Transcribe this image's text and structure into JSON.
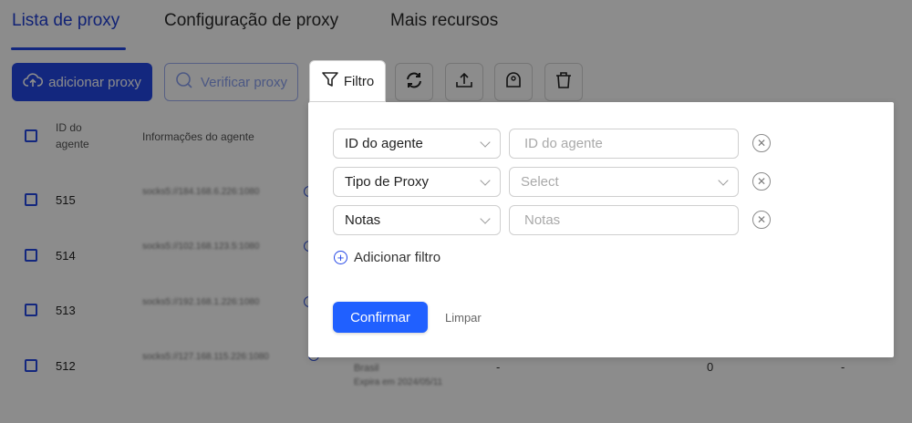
{
  "tabs": [
    "Lista de proxy",
    "Configuração de proxy",
    "Mais recursos"
  ],
  "toolbar": {
    "add_label": "adicionar proxy",
    "verify_label": "Verificar proxy",
    "filter_label": "Filtro"
  },
  "table": {
    "headers": [
      "ID do agente",
      "Informações do agente"
    ],
    "rows": [
      {
        "id": "515",
        "info": "socks5://184.168.6.226:1080"
      },
      {
        "id": "514",
        "info": "socks5://102.168.123.5:1080"
      },
      {
        "id": "513",
        "info": "socks5://192.168.1.226:1080"
      },
      {
        "id": "512",
        "info": "socks5://127.168.115.226:1080"
      }
    ],
    "row4_extra": {
      "tag": "Brasil",
      "sub": "Expira em 2024/05/11",
      "dash1": "-",
      "count": "0",
      "dash2": "-"
    }
  },
  "filter_panel": {
    "rows": [
      {
        "field": "ID do agente",
        "placeholder": "ID do agente"
      },
      {
        "field": "Tipo de Proxy",
        "placeholder": "Select"
      },
      {
        "field": "Notas",
        "placeholder": "Notas"
      }
    ],
    "add_filter": "Adicionar filtro",
    "confirm": "Confirmar",
    "clear": "Limpar"
  },
  "colors": {
    "primary": "#2447e6",
    "confirm": "#2060ff"
  }
}
